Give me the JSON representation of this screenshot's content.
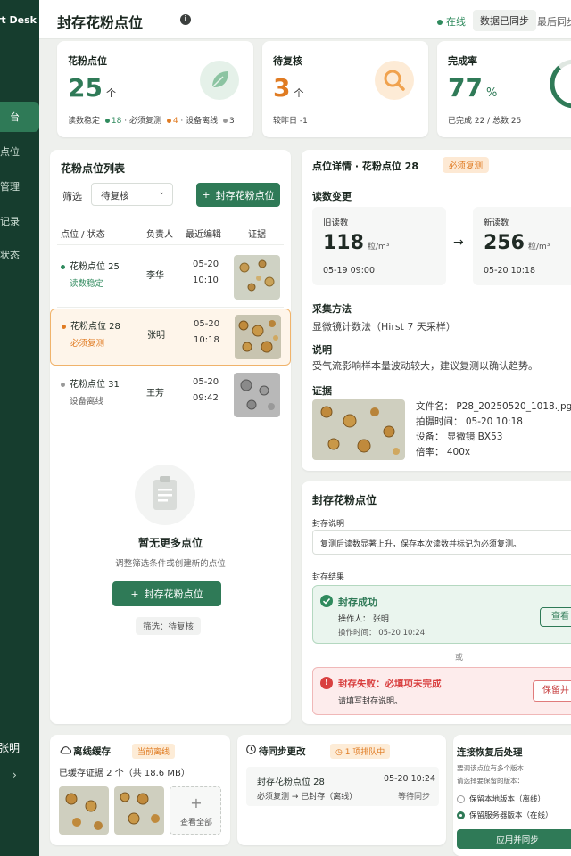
{
  "sidebar": {
    "brand": "rt Desk",
    "items": [
      {
        "label": "台"
      },
      {
        "label": "点位"
      },
      {
        "label": "管理"
      },
      {
        "label": "记录"
      },
      {
        "label": "状态"
      }
    ],
    "user": "张明",
    "chevron": "›"
  },
  "header": {
    "title": "封存花粉点位",
    "info_icon": "i",
    "online": "在线",
    "synced": "数据已同步",
    "last_sync": "最后同步"
  },
  "kpis": {
    "pollen": {
      "title": "花粉点位",
      "value": "25",
      "unit": "个",
      "sub_a": "读数稳定",
      "sub_a_n": "18",
      "sub_b": "必须复测",
      "sub_b_n": "4",
      "sub_c": "设备离线",
      "sub_c_n": "3"
    },
    "review": {
      "title": "待复核",
      "value": "3",
      "unit": "个",
      "sub": "较昨日 -1"
    },
    "rate": {
      "title": "完成率",
      "value": "77",
      "unit": "%",
      "sub": "已完成 22 / 总数 25",
      "progress": 0.88
    }
  },
  "list": {
    "title": "花粉点位列表",
    "filter_label": "筛选",
    "filter_value": "待复核",
    "add_button": "封存花粉点位",
    "columns": [
      "点位 / 状态",
      "负责人",
      "最近编辑",
      "证据"
    ],
    "rows": [
      {
        "name": "花粉点位 25",
        "status": "读数稳定",
        "owner": "李华",
        "date": "05-20",
        "time": "10:10"
      },
      {
        "name": "花粉点位 28",
        "status": "必须复测",
        "owner": "张明",
        "date": "05-20",
        "time": "10:18"
      },
      {
        "name": "花粉点位 31",
        "status": "设备离线",
        "owner": "王芳",
        "date": "05-20",
        "time": "09:42"
      }
    ],
    "empty_title": "暂无更多点位",
    "empty_sub": "调整筛选条件或创建新的点位",
    "empty_button": "封存花粉点位",
    "empty_filter": "筛选：待复核"
  },
  "detail": {
    "title": "点位详情 · 花粉点位 28",
    "badge": "必须复测",
    "change_title": "读数变更",
    "old_label": "旧读数",
    "old_value": "118",
    "old_unit": "粒/m³",
    "old_time": "05-19 09:00",
    "arrow": "→",
    "new_label": "新读数",
    "new_value": "256",
    "new_unit": "粒/m³",
    "new_time": "05-20 10:18",
    "method_label": "采集方法",
    "method": "显微镜计数法（Hirst 7 天采样）",
    "note_label": "说明",
    "note": "受气流影响样本量波动较大，建议复测以确认趋势。",
    "evidence_label": "证据",
    "file": "文件名：  P28_20250520_1018.jpg",
    "shot_time": "拍摄时间：  05-20 10:18",
    "device": "设备：  显微镜 BX53",
    "zoom": "倍率：  400x"
  },
  "seal": {
    "title": "封存花粉点位",
    "desc_label": "封存说明",
    "desc_value": "复测后读数显著上升，保存本次读数并标记为必须复测。",
    "result_label": "封存结果",
    "success_title": "封存成功",
    "success_op": "操作人：  张明",
    "success_time": "操作时间：  05-20 10:24",
    "view_button": "查看",
    "or": "或",
    "fail_title": "封存失败：必填项未完成",
    "fail_sub": "请填写封存说明。",
    "keep_button": "保留并"
  },
  "cache": {
    "title": "离线缓存",
    "badge": "当前离线",
    "info": "已缓存证据 2 个（共 18.6 MB）",
    "view_all": "查看全部"
  },
  "pending": {
    "title": "待同步更改",
    "badge": "1 项排队中",
    "item_name": "封存花粉点位 28",
    "item_time": "05-20 10:24",
    "item_change": "必须复测 → 已封存（离线）",
    "item_status": "等待同步"
  },
  "restore": {
    "title": "连接恢复后处理",
    "line1": "要调该点位有多个版本",
    "line2": "请选择要保留的版本：",
    "opt1": "保留本地版本（离线）",
    "opt2": "保留服务器版本（在线）",
    "button": "应用并同步"
  },
  "colors": {
    "accent": "#2f7a57",
    "warning": "#e07b22",
    "danger": "#d94040"
  }
}
